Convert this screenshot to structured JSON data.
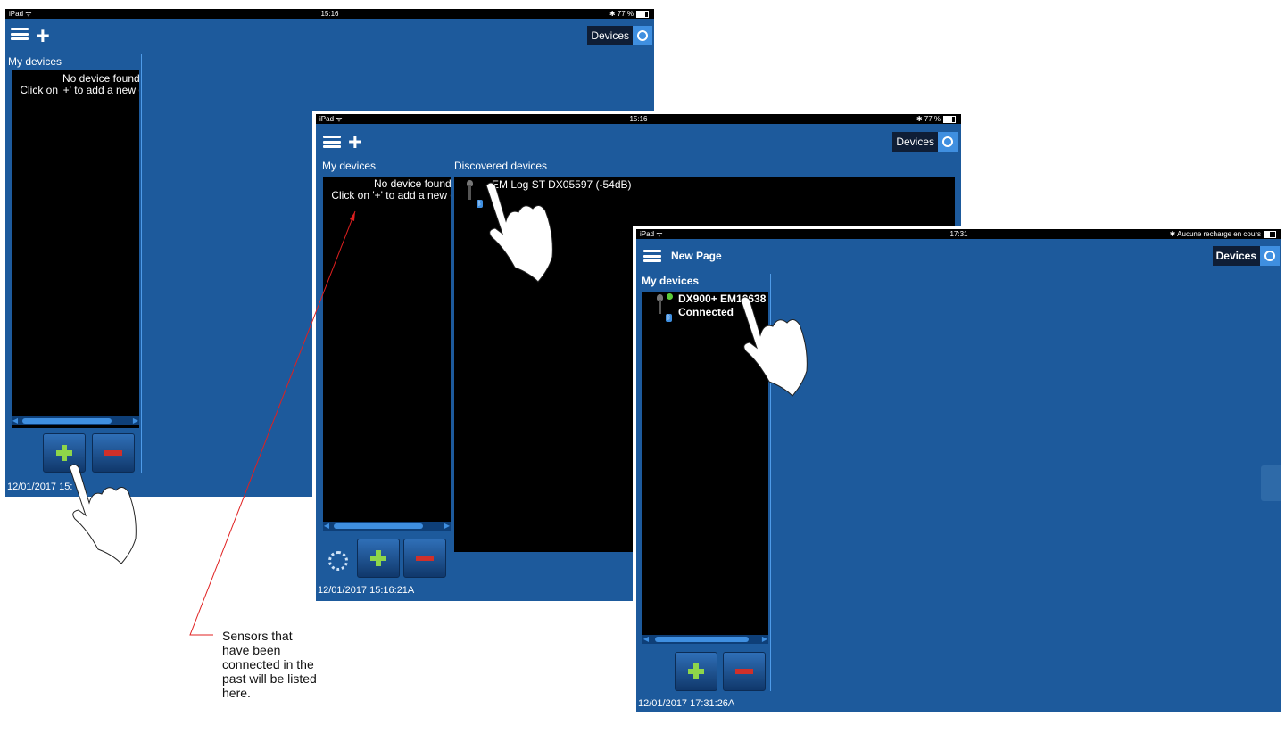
{
  "status_bar": {
    "screen1": {
      "device": "iPad ᯤ",
      "time": "15:16",
      "battery": "✱ 77 %"
    },
    "screen2": {
      "device": "iPad ᯤ",
      "time": "15:16",
      "battery": "✱ 77 %"
    },
    "screen3": {
      "device": "iPad ᯤ",
      "time": "17:31",
      "battery": "✱ Aucune recharge en cours"
    }
  },
  "header": {
    "devices_label": "Devices",
    "page_title": "New Page"
  },
  "my_devices": {
    "title": "My devices",
    "empty_line1": "No device found.",
    "empty_line2": "Click on '+' to add a new d"
  },
  "discovered": {
    "title": "Discovered devices",
    "item1": "EM Log ST DX05597 (-54dB)"
  },
  "connected_device": {
    "name": "DX900+ EM10638",
    "status": "Connected"
  },
  "timestamps": {
    "screen1": "12/01/2017 15:",
    "screen2": "12/01/2017 15:16:21A",
    "screen3": "12/01/2017 17:31:26A"
  },
  "callout": {
    "text": "Sensors that have been connected in the past will be listed here."
  },
  "icons": [
    "menu-icon",
    "plus-icon",
    "camera-icon",
    "bluetooth-icon",
    "sensor-icon",
    "spinner-icon",
    "hand-pointer-icon"
  ],
  "colors": {
    "app_bg": "#1d5a9c",
    "panel_bg": "#000000",
    "accent": "#3f8fe0",
    "add_green": "#8ed64a",
    "remove_red": "#d0302a",
    "callout_line": "#e02020"
  }
}
